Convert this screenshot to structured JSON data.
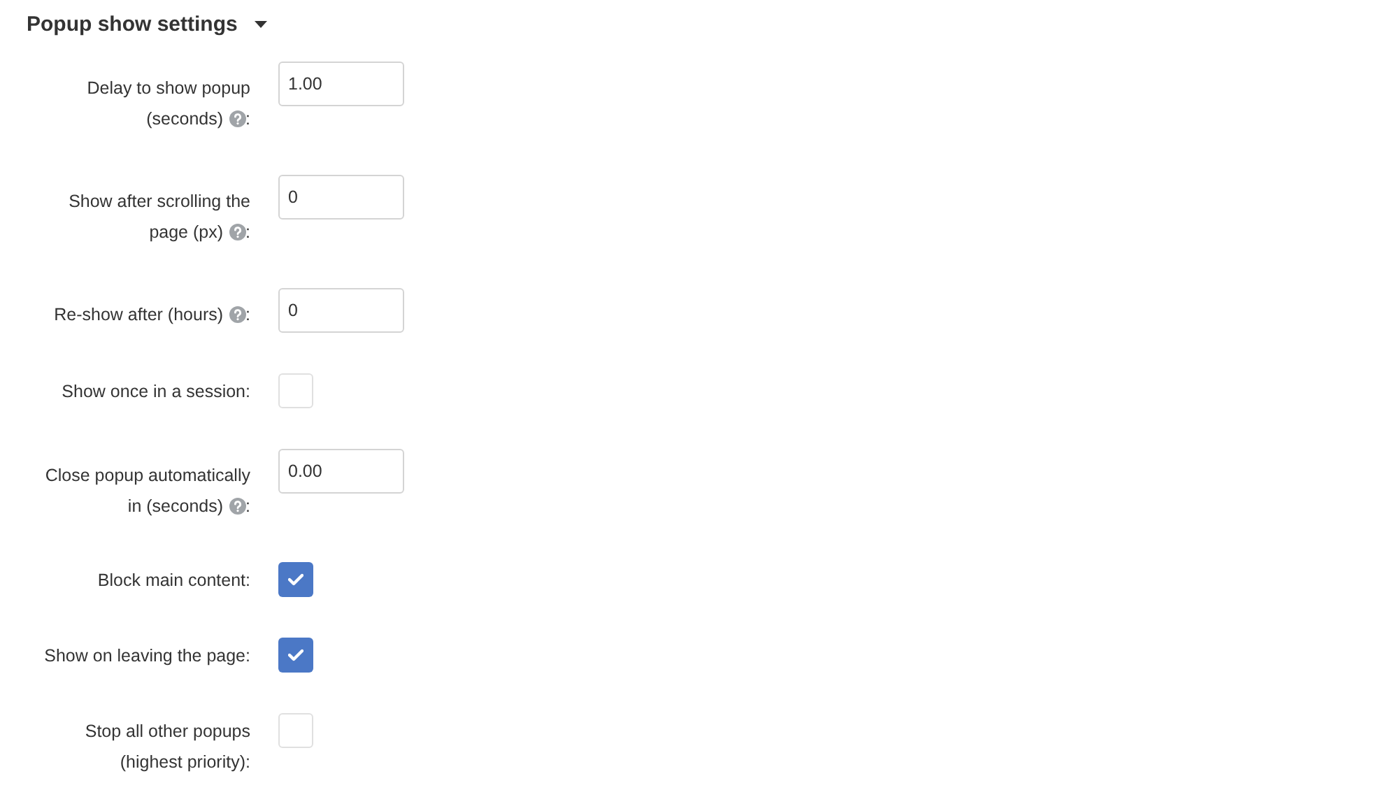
{
  "section": {
    "title": "Popup show settings",
    "expanded": true
  },
  "fields": [
    {
      "kind": "number",
      "lines": [
        "Delay to show popup",
        "(seconds)"
      ],
      "help": true,
      "punct": ":",
      "value": "1.00"
    },
    {
      "kind": "number",
      "lines": [
        "Show after scrolling the",
        "page (px)"
      ],
      "help": true,
      "punct": ":",
      "value": "0"
    },
    {
      "kind": "number",
      "lines": [
        "Re-show after (hours)"
      ],
      "help": true,
      "punct": ":",
      "value": "0"
    },
    {
      "kind": "checkbox",
      "lines": [
        "Show once in a session"
      ],
      "help": false,
      "punct": ":",
      "checked": false
    },
    {
      "kind": "number",
      "lines": [
        "Close popup automatically",
        "in (seconds)"
      ],
      "help": true,
      "punct": ":",
      "value": "0.00"
    },
    {
      "kind": "checkbox",
      "lines": [
        "Block main content"
      ],
      "help": false,
      "punct": ":",
      "checked": true
    },
    {
      "kind": "checkbox",
      "lines": [
        "Show on leaving the page"
      ],
      "help": false,
      "punct": ":",
      "checked": true
    },
    {
      "kind": "checkbox",
      "lines": [
        "Stop all other popups",
        "(highest priority)"
      ],
      "help": false,
      "punct": ":",
      "checked": false
    }
  ]
}
